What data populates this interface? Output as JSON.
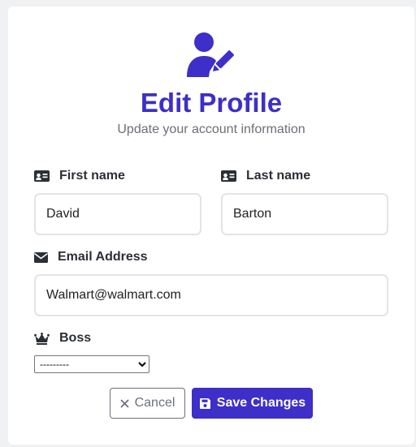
{
  "header": {
    "icon": "user-edit-icon",
    "title": "Edit Profile",
    "subtitle": "Update your account information"
  },
  "form": {
    "first_name": {
      "label": "First name",
      "value": "David",
      "icon": "id-card-icon"
    },
    "last_name": {
      "label": "Last name",
      "value": "Barton",
      "icon": "id-card-icon"
    },
    "email": {
      "label": "Email Address",
      "value": "Walmart@walmart.com",
      "icon": "envelope-icon"
    },
    "boss": {
      "label": "Boss",
      "selected": "---------",
      "icon": "crown-icon"
    }
  },
  "buttons": {
    "cancel_label": "Cancel",
    "save_label": "Save Changes"
  },
  "colors": {
    "accent": "#3d2fc7",
    "muted": "#6c727a",
    "card": "#ffffff",
    "background": "#f0f1f3"
  }
}
